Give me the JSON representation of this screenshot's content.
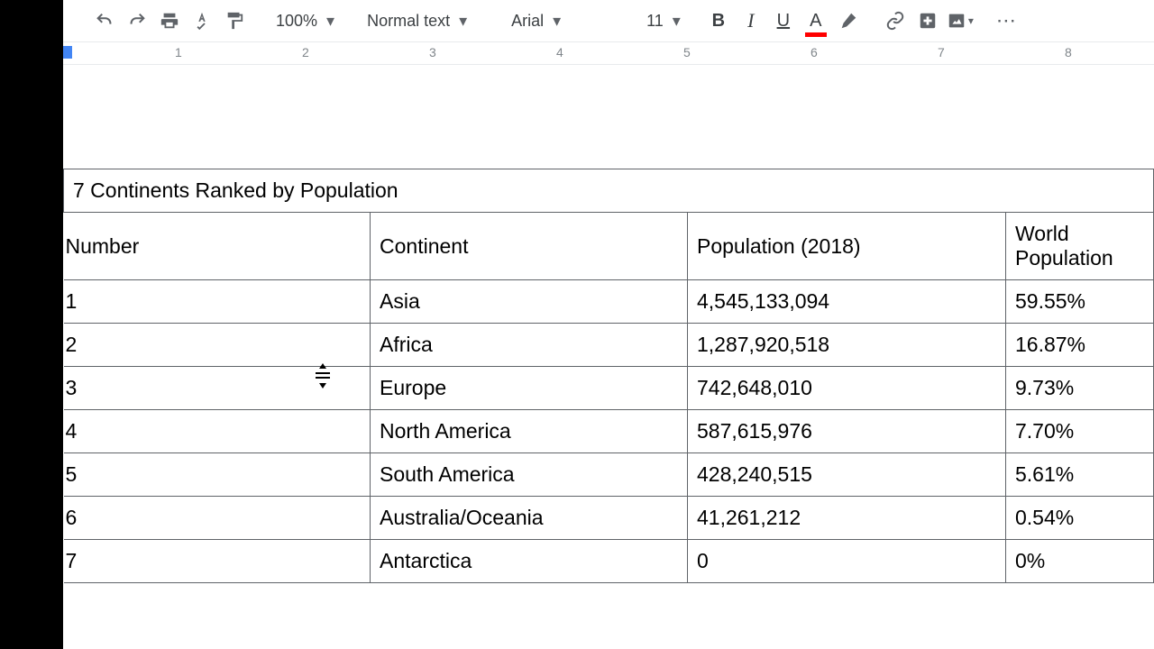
{
  "toolbar": {
    "zoom": "100%",
    "style": "Normal text",
    "font": "Arial",
    "fontSize": "11"
  },
  "ruler": {
    "marks": [
      "1",
      "2",
      "3",
      "4",
      "5",
      "6",
      "7",
      "8"
    ]
  },
  "table": {
    "title": "7 Continents Ranked by Population",
    "headers": [
      "Number",
      "Continent",
      "Population (2018)",
      "World Population"
    ],
    "rows": [
      {
        "num": "1",
        "continent": "Asia",
        "pop": "4,545,133,094",
        "pct": "59.55%"
      },
      {
        "num": "2",
        "continent": "Africa",
        "pop": "1,287,920,518",
        "pct": "16.87%"
      },
      {
        "num": "3",
        "continent": "Europe",
        "pop": "742,648,010",
        "pct": "9.73%"
      },
      {
        "num": "4",
        "continent": "North America",
        "pop": "587,615,976",
        "pct": "7.70%"
      },
      {
        "num": "5",
        "continent": "South America",
        "pop": "428,240,515",
        "pct": "5.61%"
      },
      {
        "num": "6",
        "continent": "Australia/Oceania",
        "pop": "41,261,212",
        "pct": "0.54%"
      },
      {
        "num": "7",
        "continent": "Antarctica",
        "pop": "0",
        "pct": "0%"
      }
    ]
  }
}
